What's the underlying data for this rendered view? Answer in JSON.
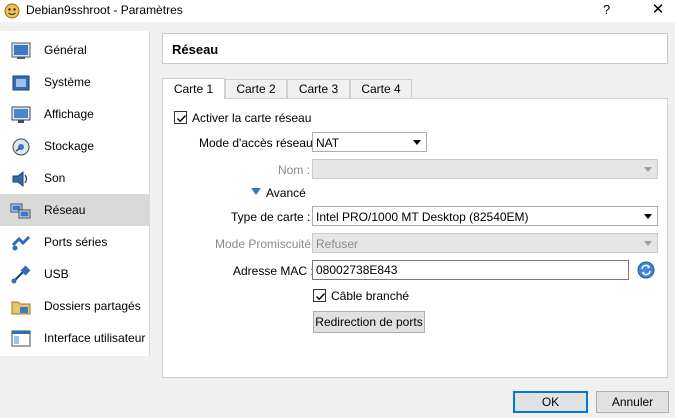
{
  "window": {
    "title": "Debian9sshroot - Paramètres",
    "help": "?",
    "close": "✕"
  },
  "sidebar": {
    "items": [
      {
        "label": "Général",
        "icon": "general-icon"
      },
      {
        "label": "Système",
        "icon": "system-icon"
      },
      {
        "label": "Affichage",
        "icon": "display-icon"
      },
      {
        "label": "Stockage",
        "icon": "storage-icon"
      },
      {
        "label": "Son",
        "icon": "sound-icon"
      },
      {
        "label": "Réseau",
        "icon": "network-icon",
        "selected": true
      },
      {
        "label": "Ports séries",
        "icon": "serial-ports-icon"
      },
      {
        "label": "USB",
        "icon": "usb-icon"
      },
      {
        "label": "Dossiers partagés",
        "icon": "shared-folders-icon"
      },
      {
        "label": "Interface utilisateur",
        "icon": "user-interface-icon"
      }
    ]
  },
  "section": {
    "title": "Réseau"
  },
  "tabs": [
    {
      "label": "Carte 1",
      "active": true
    },
    {
      "label": "Carte 2"
    },
    {
      "label": "Carte 3"
    },
    {
      "label": "Carte 4"
    }
  ],
  "adapter": {
    "enable_label": "Activer la carte réseau",
    "enable_checked": true,
    "access_mode_label": "Mode d'accès réseau :",
    "access_mode_value": "NAT",
    "name_label": "Nom :",
    "name_value": "",
    "advanced_label": "Avancé",
    "adapter_type_label": "Type de carte :",
    "adapter_type_value": "Intel PRO/1000 MT Desktop (82540EM)",
    "promisc_label": "Mode Promiscuité :",
    "promisc_value": "Refuser",
    "mac_label": "Adresse MAC :",
    "mac_value": "08002738E843",
    "cable_label": "Câble branché",
    "cable_checked": true,
    "port_forwarding_label": "Redirection de ports"
  },
  "footer": {
    "ok_label": "OK",
    "cancel_label": "Annuler"
  },
  "colors": {
    "accent": "#0078d7",
    "selected_bg": "#d9d9d9",
    "disabled_text": "#8a8a8a"
  }
}
